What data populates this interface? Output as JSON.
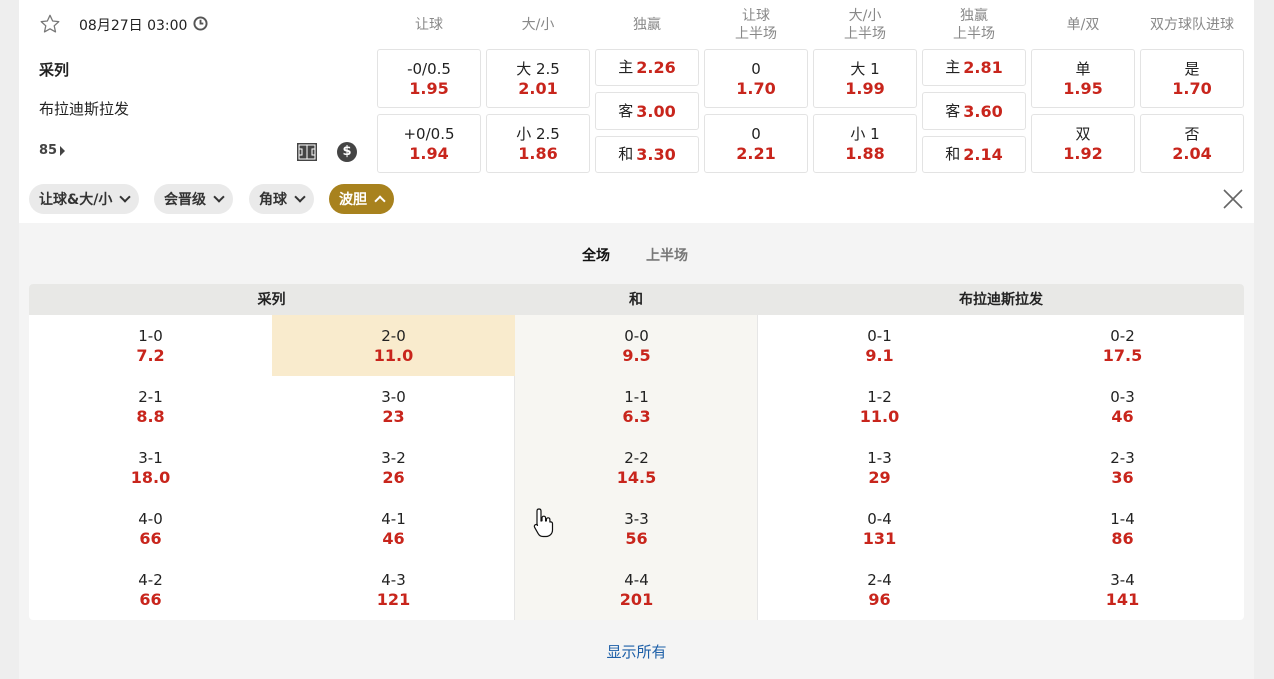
{
  "match": {
    "datetime": "08月27日 03:00",
    "home_team": "采列",
    "away_team": "布拉迪斯拉发",
    "minute": "85"
  },
  "columns": [
    {
      "line1": "让球",
      "line2": ""
    },
    {
      "line1": "大/小",
      "line2": ""
    },
    {
      "line1": "独赢",
      "line2": ""
    },
    {
      "line1": "让球",
      "line2": "上半场"
    },
    {
      "line1": "大/小",
      "line2": "上半场"
    },
    {
      "line1": "独赢",
      "line2": "上半场"
    },
    {
      "line1": "单/双",
      "line2": ""
    },
    {
      "line1": "双方球队进球",
      "line2": ""
    }
  ],
  "odds": {
    "handicap": [
      {
        "label": "-0/0.5",
        "odd": "1.95"
      },
      {
        "label": "+0/0.5",
        "odd": "1.94"
      }
    ],
    "over_under": [
      {
        "label": "大 2.5",
        "odd": "2.01"
      },
      {
        "label": "小 2.5",
        "odd": "1.86"
      }
    ],
    "moneyline": [
      {
        "label": "主",
        "odd": "2.26"
      },
      {
        "label": "客",
        "odd": "3.00"
      },
      {
        "label": "和",
        "odd": "3.30"
      }
    ],
    "handicap_1h": [
      {
        "label": "0",
        "odd": "1.70"
      },
      {
        "label": "0",
        "odd": "2.21"
      }
    ],
    "over_under_1h": [
      {
        "label": "大 1",
        "odd": "1.99"
      },
      {
        "label": "小 1",
        "odd": "1.88"
      }
    ],
    "moneyline_1h": [
      {
        "label": "主",
        "odd": "2.81"
      },
      {
        "label": "客",
        "odd": "3.60"
      },
      {
        "label": "和",
        "odd": "2.14"
      }
    ],
    "odd_even": [
      {
        "label": "单",
        "odd": "1.95"
      },
      {
        "label": "双",
        "odd": "1.92"
      }
    ],
    "btts": [
      {
        "label": "是",
        "odd": "1.70"
      },
      {
        "label": "否",
        "odd": "2.04"
      }
    ]
  },
  "chips": [
    {
      "label": "让球&大/小",
      "active": false
    },
    {
      "label": "会晋级",
      "active": false
    },
    {
      "label": "角球",
      "active": false
    },
    {
      "label": "波胆",
      "active": true
    }
  ],
  "tabs": [
    {
      "label": "全场",
      "active": true
    },
    {
      "label": "上半场",
      "active": false
    }
  ],
  "correct_score": {
    "headers": {
      "home": "采列",
      "draw": "和",
      "away": "布拉迪斯拉发"
    },
    "home_col1": [
      {
        "s": "1-0",
        "o": "7.2"
      },
      {
        "s": "2-1",
        "o": "8.8"
      },
      {
        "s": "3-1",
        "o": "18.0"
      },
      {
        "s": "4-0",
        "o": "66"
      },
      {
        "s": "4-2",
        "o": "66"
      }
    ],
    "home_col2": [
      {
        "s": "2-0",
        "o": "11.0"
      },
      {
        "s": "3-0",
        "o": "23"
      },
      {
        "s": "3-2",
        "o": "26"
      },
      {
        "s": "4-1",
        "o": "46"
      },
      {
        "s": "4-3",
        "o": "121"
      }
    ],
    "draw": [
      {
        "s": "0-0",
        "o": "9.5"
      },
      {
        "s": "1-1",
        "o": "6.3"
      },
      {
        "s": "2-2",
        "o": "14.5"
      },
      {
        "s": "3-3",
        "o": "56"
      },
      {
        "s": "4-4",
        "o": "201"
      }
    ],
    "away_col1": [
      {
        "s": "0-1",
        "o": "9.1"
      },
      {
        "s": "1-2",
        "o": "11.0"
      },
      {
        "s": "1-3",
        "o": "29"
      },
      {
        "s": "0-4",
        "o": "131"
      },
      {
        "s": "2-4",
        "o": "96"
      }
    ],
    "away_col2": [
      {
        "s": "0-2",
        "o": "17.5"
      },
      {
        "s": "0-3",
        "o": "46"
      },
      {
        "s": "2-3",
        "o": "36"
      },
      {
        "s": "1-4",
        "o": "86"
      },
      {
        "s": "3-4",
        "o": "141"
      }
    ]
  },
  "show_all": "显示所有",
  "colors": {
    "odd_red": "#c8251c",
    "active_chip": "#a8821e",
    "highlight": "#f9ebcd",
    "link": "#1d5fa8"
  }
}
